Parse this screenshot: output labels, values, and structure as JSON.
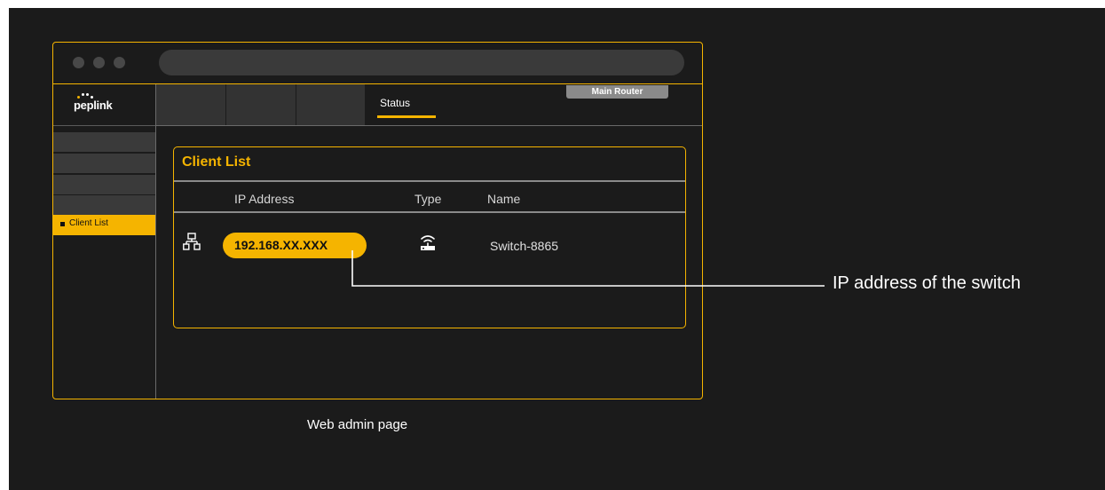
{
  "brand": {
    "name": "peplink",
    "dot_colors": [
      "#f5b400",
      "#ffffff",
      "#ffffff",
      "#ffffff"
    ]
  },
  "top_nav": {
    "tabs": [
      "",
      "",
      "",
      "Status"
    ],
    "active_tab": "Status",
    "device_badge": "Main Router"
  },
  "sidebar": {
    "active_item": "Client List"
  },
  "client_list": {
    "title": "Client List",
    "columns": [
      "IP Address",
      "Type",
      "Name"
    ],
    "rows": [
      {
        "ip": "192.168.XX.XXX",
        "type_icon": "router-icon",
        "name": "Switch-8865",
        "device_icon": "network-icon"
      }
    ]
  },
  "callout": {
    "text": "IP address of the switch"
  },
  "caption": "Web admin page",
  "colors": {
    "accent": "#f5b400",
    "background": "#1b1b1b",
    "tile": "#3a3a3a"
  }
}
